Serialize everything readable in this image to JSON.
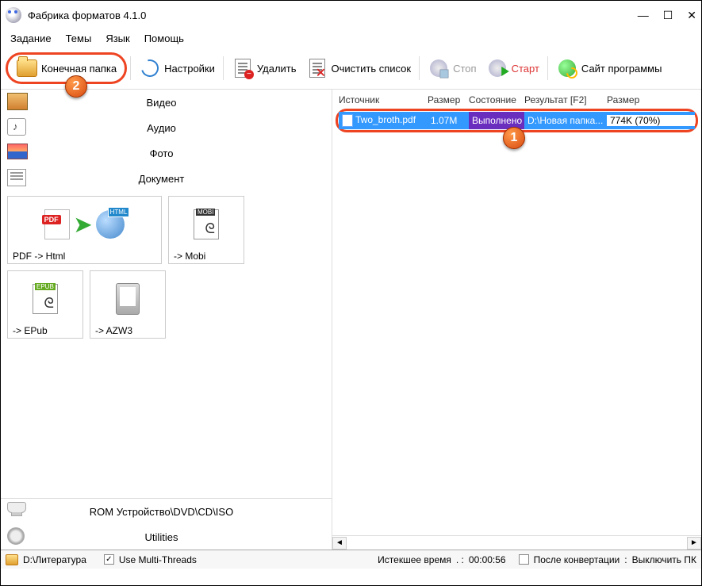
{
  "window": {
    "title": "Фабрика форматов 4.1.0"
  },
  "menu": {
    "task": "Задание",
    "themes": "Темы",
    "lang": "Язык",
    "help": "Помощь"
  },
  "toolbar": {
    "dest_folder": "Конечная папка",
    "settings": "Настройки",
    "delete": "Удалить",
    "clear": "Очистить список",
    "stop": "Стоп",
    "start": "Старт",
    "site": "Сайт программы"
  },
  "categories": {
    "video": "Видео",
    "audio": "Аудио",
    "photo": "Фото",
    "document": "Документ",
    "rom": "ROM Устройство\\DVD\\CD\\ISO",
    "utilities": "Utilities"
  },
  "doc_targets": {
    "pdf_html": "PDF -> Html",
    "mobi": "-> Mobi",
    "epub": "-> EPub",
    "azw3": "-> AZW3"
  },
  "table": {
    "headers": {
      "source": "Источник",
      "size": "Размер",
      "state": "Состояние",
      "result": "Результат [F2]",
      "size2": "Размер"
    },
    "row": {
      "source": "Two_broth.pdf",
      "size": "1.07M",
      "state": "Выполнено",
      "result": "D:\\Новая папка...",
      "size2": "774K  (70%)"
    }
  },
  "status": {
    "path": "D:\\Литература",
    "threads": "Use Multi-Threads",
    "elapsed_label": "Истекшее время",
    "elapsed_value": "00:00:56",
    "after_label": "После конвертации",
    "after_value": "Выключить ПК"
  },
  "badges": {
    "one": "1",
    "two": "2"
  }
}
